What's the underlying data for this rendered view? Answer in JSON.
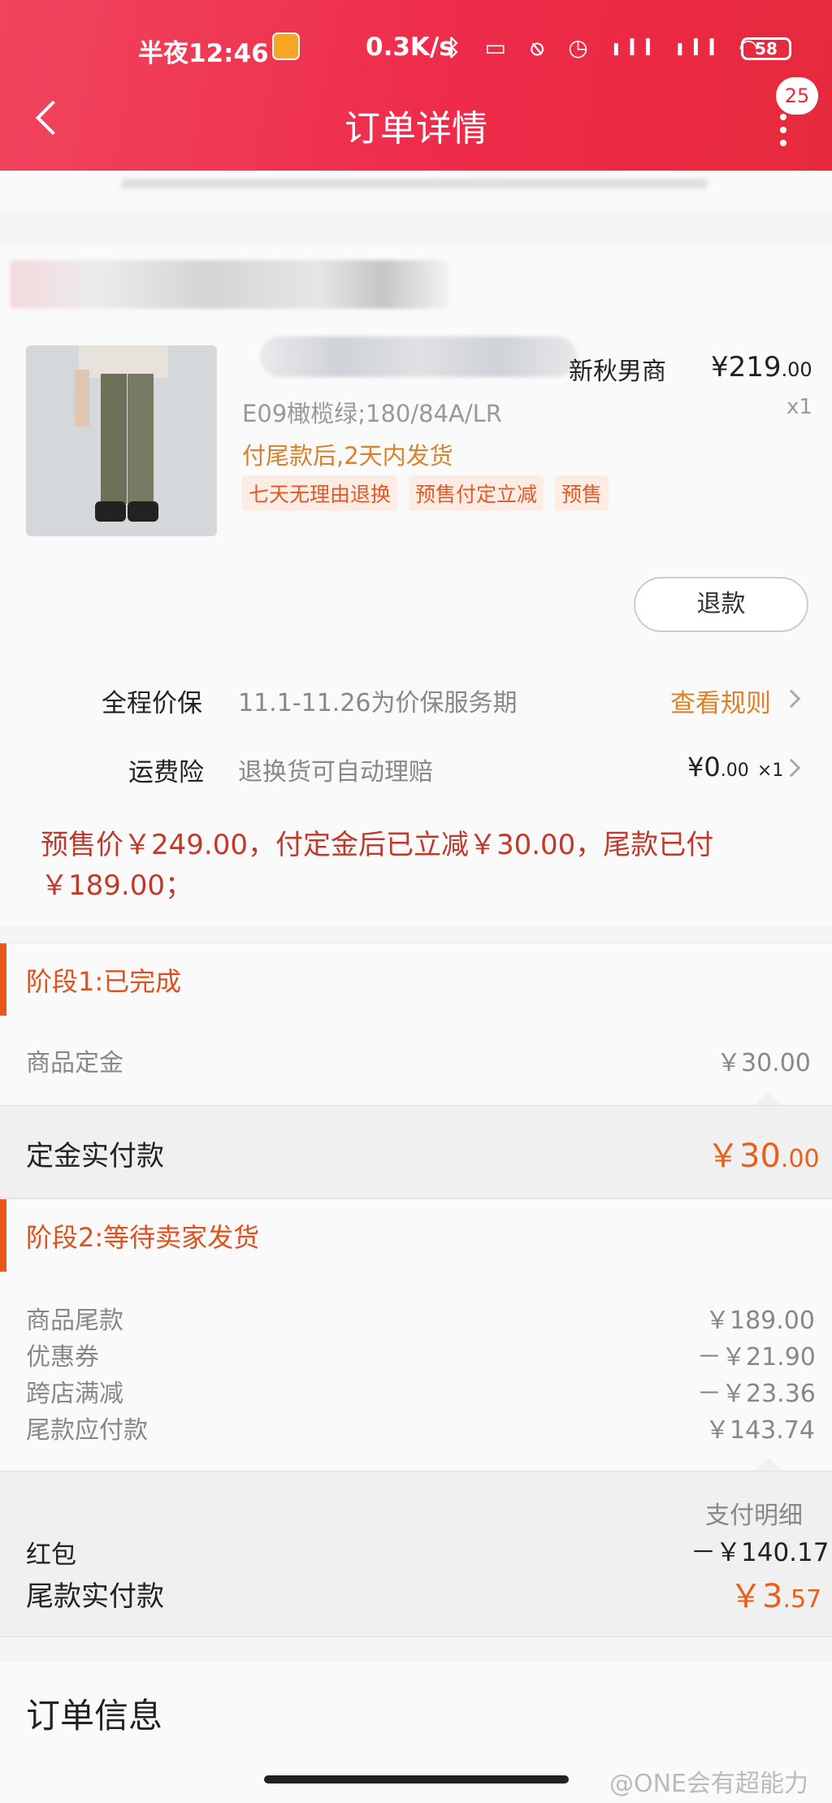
{
  "status_bar": {
    "time": "半夜12:46",
    "network_speed": "0.3K/s",
    "icons": "ᛒ ▭ ⍉ ◷ ıll ıll ◠",
    "battery": "58"
  },
  "navbar": {
    "title": "订单详情",
    "message_count": "25"
  },
  "product": {
    "title_visible": "新秋男商",
    "price_main": "¥219",
    "price_decimal": ".00",
    "sku": "E09橄榄绿;180/84A/LR",
    "quantity": "x1",
    "ship_note": "付尾款后,2天内发货",
    "tags": [
      "七天无理由退换",
      "预售付定立减",
      "预售"
    ],
    "refund_button": "退款"
  },
  "services": {
    "price_protect_label": "全程价保",
    "price_protect_value": "11.1-11.26为价保服务期",
    "price_protect_link": "查看规则",
    "shipping_insurance_label": "运费险",
    "shipping_insurance_value": "退换货可自动理赔",
    "shipping_insurance_price_main": "¥0",
    "shipping_insurance_price_decimal": ".00",
    "shipping_insurance_qty": "×1"
  },
  "presale_note": "预售价￥249.00，付定金后已立减￥30.00，尾款已付￥189.00；",
  "stage1": {
    "label": "阶段1:已完成",
    "items": [
      {
        "name": "商品定金",
        "amount": "￥30.00"
      }
    ],
    "total_label": "定金实付款",
    "total_main": "￥30",
    "total_decimal": ".00"
  },
  "stage2": {
    "label": "阶段2:等待卖家发货",
    "items": [
      {
        "name": "商品尾款",
        "amount": "￥189.00"
      },
      {
        "name": "优惠券",
        "amount": "－￥21.90"
      },
      {
        "name": "跨店满减",
        "amount": "－￥23.36"
      },
      {
        "name": "尾款应付款",
        "amount": "￥143.74"
      }
    ],
    "payment_detail_label": "支付明细",
    "red_packet_label": "红包",
    "red_packet_amount": "－￥140.17",
    "total_label": "尾款实付款",
    "total_main": "￥3",
    "total_decimal": ".57"
  },
  "order_info": {
    "title": "订单信息"
  },
  "watermark": "@ONE会有超能力",
  "colors": {
    "header_red": "#ee2b4a",
    "accent_orange": "#e8581c",
    "presale_red": "#c0392b",
    "link_orange": "#d9822b"
  }
}
